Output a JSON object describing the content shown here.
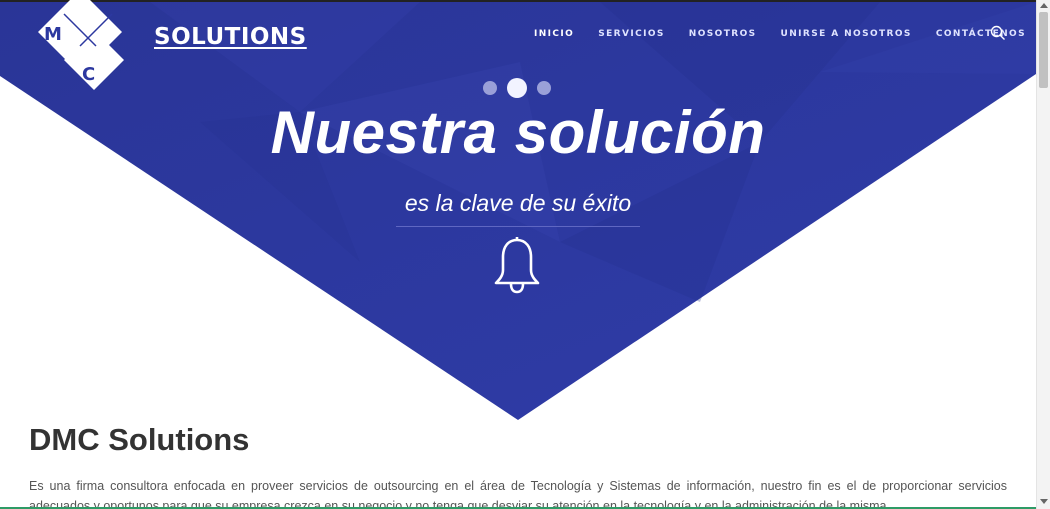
{
  "logo": {
    "letters": [
      "M",
      "C"
    ],
    "text": "SOLUTIONS"
  },
  "nav": {
    "items": [
      {
        "label": "INICIO",
        "active": true
      },
      {
        "label": "SERVICIOS",
        "active": false
      },
      {
        "label": "NOSOTROS",
        "active": false
      },
      {
        "label": "UNIRSE A NOSOTROS",
        "active": false
      },
      {
        "label": "CONTÁCTENOS",
        "active": false
      }
    ],
    "search_icon": "search-icon"
  },
  "hero": {
    "headline": "Nuestra solución",
    "subheadline": "es la clave de su éxito",
    "icon": "bell-icon",
    "slides_count": 3,
    "active_slide": 2
  },
  "content": {
    "title": "DMC Solutions",
    "paragraph": "Es una firma consultora enfocada en proveer servicios de outsourcing en el área de Tecnología y Sistemas de información, nuestro fin es el de proporcionar servicios adecuados y oportunos para que su empresa crezca en su negocio y no tenga que desviar su atención en la tecnología y en la administración de la misma."
  },
  "colors": {
    "hero_blue": "#2c38a0",
    "text_dark": "#333333",
    "accent_green": "#2e9b66"
  }
}
